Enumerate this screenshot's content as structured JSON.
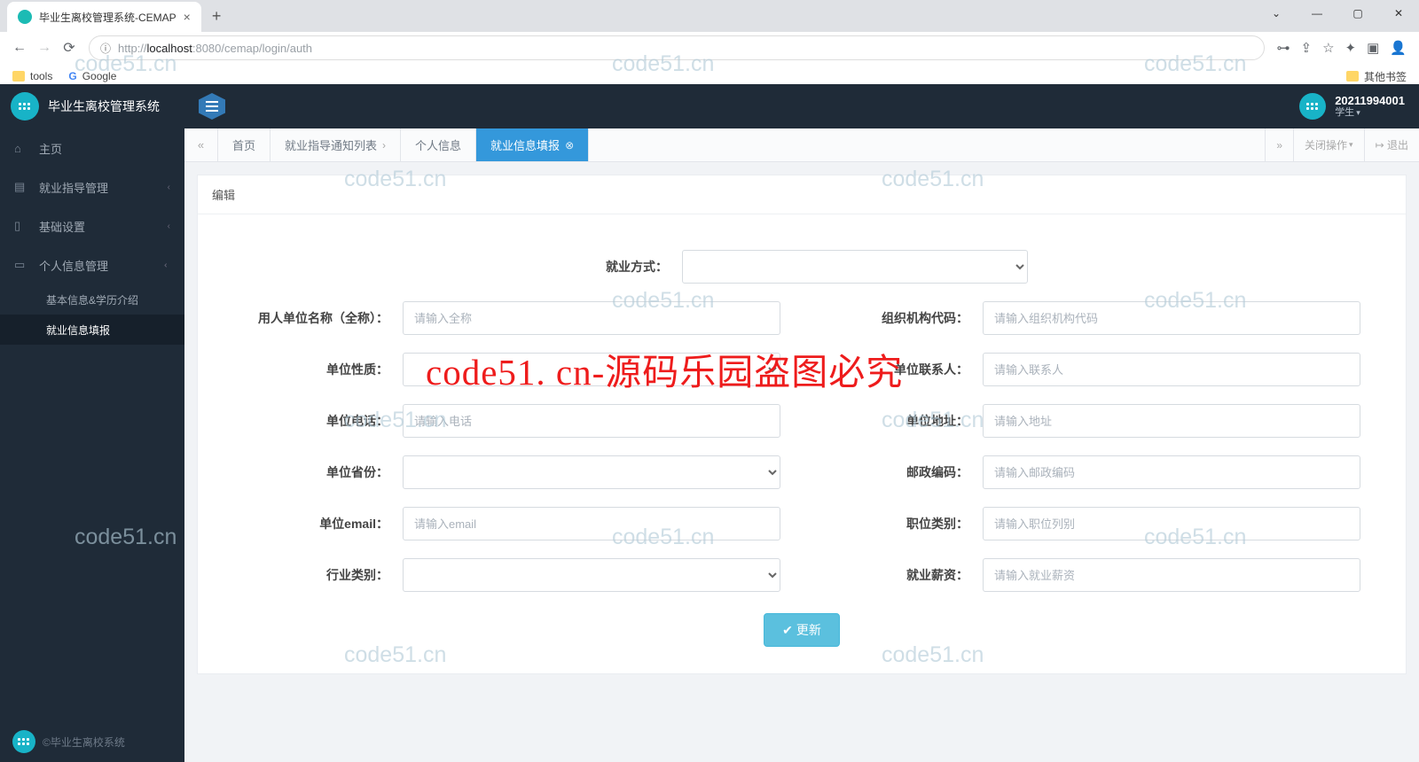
{
  "browser": {
    "tab_title": "毕业生离校管理系统-CEMAP",
    "new_tab": "+",
    "window": {
      "dropdown": "⌄",
      "min": "—",
      "max": "▢",
      "close": "✕"
    },
    "nav": {
      "back": "←",
      "forward": "→",
      "reload": "⟳"
    },
    "url_prefix_proto": "http://",
    "url_host": "localhost",
    "url_port_path": ":8080/cemap/login/auth",
    "addr_icon": "ⓘ",
    "bar_icons": [
      "⊶",
      "⇪",
      "☆",
      "✦",
      "▣",
      "👤"
    ],
    "bookmarks": {
      "tools": "tools",
      "google": "Google",
      "other": "其他书签"
    }
  },
  "app": {
    "brand": "毕业生离校管理系统",
    "footer": "©毕业生离校系统",
    "user": {
      "id": "20211994001",
      "role": "学生"
    }
  },
  "sidebar": [
    {
      "icon": "⌂",
      "label": "主页",
      "has_children": false
    },
    {
      "icon": "▤",
      "label": "就业指导管理",
      "has_children": true
    },
    {
      "icon": "▯",
      "label": "基础设置",
      "has_children": true
    },
    {
      "icon": "▭",
      "label": "个人信息管理",
      "has_children": true,
      "expanded": true,
      "children": [
        {
          "label": "基本信息&学历介绍",
          "active": false
        },
        {
          "label": "就业信息填报",
          "active": true
        }
      ]
    }
  ],
  "tabs": {
    "scroll_left": "«",
    "items": [
      {
        "label": "首页",
        "closable": false,
        "active": false
      },
      {
        "label": "就业指导通知列表",
        "closable": true,
        "active": false
      },
      {
        "label": "个人信息",
        "closable": false,
        "active": false
      },
      {
        "label": "就业信息填报",
        "closable": true,
        "active": true
      }
    ],
    "scroll_right": "»",
    "close_ops": "关闭操作",
    "logout": "退出",
    "logout_icon": "↦"
  },
  "panel": {
    "title": "编辑"
  },
  "form": {
    "employ_mode": {
      "label": "就业方式："
    },
    "employer_name": {
      "label": "用人单位名称（全称）：",
      "placeholder": "请输入全称"
    },
    "org_code": {
      "label": "组织机构代码：",
      "placeholder": "请输入组织机构代码"
    },
    "nature": {
      "label": "单位性质："
    },
    "contact": {
      "label": "单位联系人：",
      "placeholder": "请输入联系人"
    },
    "phone": {
      "label": "单位电话：",
      "placeholder": "请输入电话"
    },
    "address": {
      "label": "单位地址：",
      "placeholder": "请输入地址"
    },
    "province": {
      "label": "单位省份："
    },
    "postcode": {
      "label": "邮政编码：",
      "placeholder": "请输入邮政编码"
    },
    "email": {
      "label": "单位email：",
      "placeholder": "请输入email"
    },
    "job_type": {
      "label": "职位类别：",
      "placeholder": "请输入职位列别"
    },
    "industry": {
      "label": "行业类别："
    },
    "salary": {
      "label": "就业薪资：",
      "placeholder": "请输入就业薪资"
    },
    "submit": "更新"
  },
  "watermarks": {
    "text": "code51.cn",
    "red": "code51. cn-源码乐园盗图必究"
  }
}
